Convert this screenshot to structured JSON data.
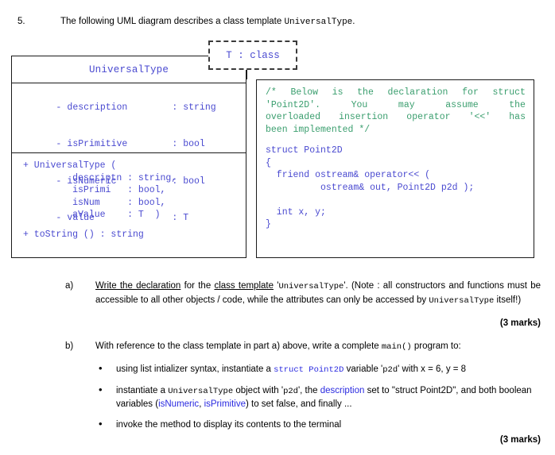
{
  "question": {
    "number": "5.",
    "intro_before_code": "The following UML diagram describes a class template ",
    "intro_code": "UniversalType",
    "intro_after_code": "."
  },
  "uml": {
    "template_param": "T : class",
    "class_name": "UniversalType",
    "attributes": [
      {
        "visibility": "-",
        "name": "description",
        "type": ": string"
      },
      {
        "visibility": "-",
        "name": "isPrimitive",
        "type": ": bool"
      },
      {
        "visibility": "-",
        "name": "isNumeric",
        "type": ": bool"
      },
      {
        "visibility": "-",
        "name": "value",
        "type": ": T"
      }
    ],
    "operations": [
      "+ UniversalType (",
      "         descriptn : string,",
      "         isPrimi   : bool,",
      "         isNum     : bool,",
      "         aValue    : T  )",
      "+ toString () : string"
    ]
  },
  "code_box": {
    "comment_lines": [
      [
        "/*",
        "Below",
        "is",
        "the",
        "declaration",
        "for",
        "struct"
      ],
      [
        "'Point2D'.",
        "You",
        "may",
        "assume",
        "the"
      ],
      [
        "overloaded",
        "insertion",
        "operator",
        "'<<'",
        "has"
      ]
    ],
    "comment_last_line": "been implemented */",
    "code_lines": [
      "struct Point2D",
      "{",
      "  friend ostream& operator<< (",
      "          ostream& out, Point2D p2d );",
      "",
      "  int x, y;",
      "}"
    ]
  },
  "parts": {
    "a": {
      "label": "a)",
      "text_1": "Write the declaration",
      "text_2": " for the ",
      "text_3": "class template",
      "text_4": " '",
      "code_1": "UniversalType",
      "text_5": "'. (Note : all constructors and functions must be accessible to all other objects / code, while the attributes can only be accessed by ",
      "code_2": "UniversalType",
      "text_6": " itself!)",
      "marks": "(3 marks)"
    },
    "b": {
      "label": "b)",
      "intro_1": "With reference to the class template in part a) above, write a complete ",
      "intro_code": "main()",
      "intro_2": " program to:",
      "bullets": [
        {
          "seg_1": "using list intializer syntax, instantiate a ",
          "code_1": "struct Point2D",
          "seg_2": " variable '",
          "code_2": "p2d",
          "seg_3": "' with x = 6, y = 8"
        },
        {
          "seg_1": "instantiate a ",
          "code_1": "UniversalType",
          "seg_2": " object with '",
          "code_2": "p2d",
          "seg_3": "', the ",
          "kw_1": "description",
          "seg_4": " set to \"struct Point2D\", and both boolean variables (",
          "kw_2": "isNumeric",
          "seg_5": ", ",
          "kw_3": "isPrimitive",
          "seg_6": ") to set false, and finally ..."
        },
        {
          "seg_1": "invoke the method to display its contents to the terminal"
        }
      ],
      "marks": "(3 marks)"
    }
  },
  "colors": {
    "code_blue": "#4a4ad0",
    "comment_green": "#3a9e6e",
    "keyword_blue": "#2a2ae0",
    "box_border": "#1a1a1a"
  }
}
